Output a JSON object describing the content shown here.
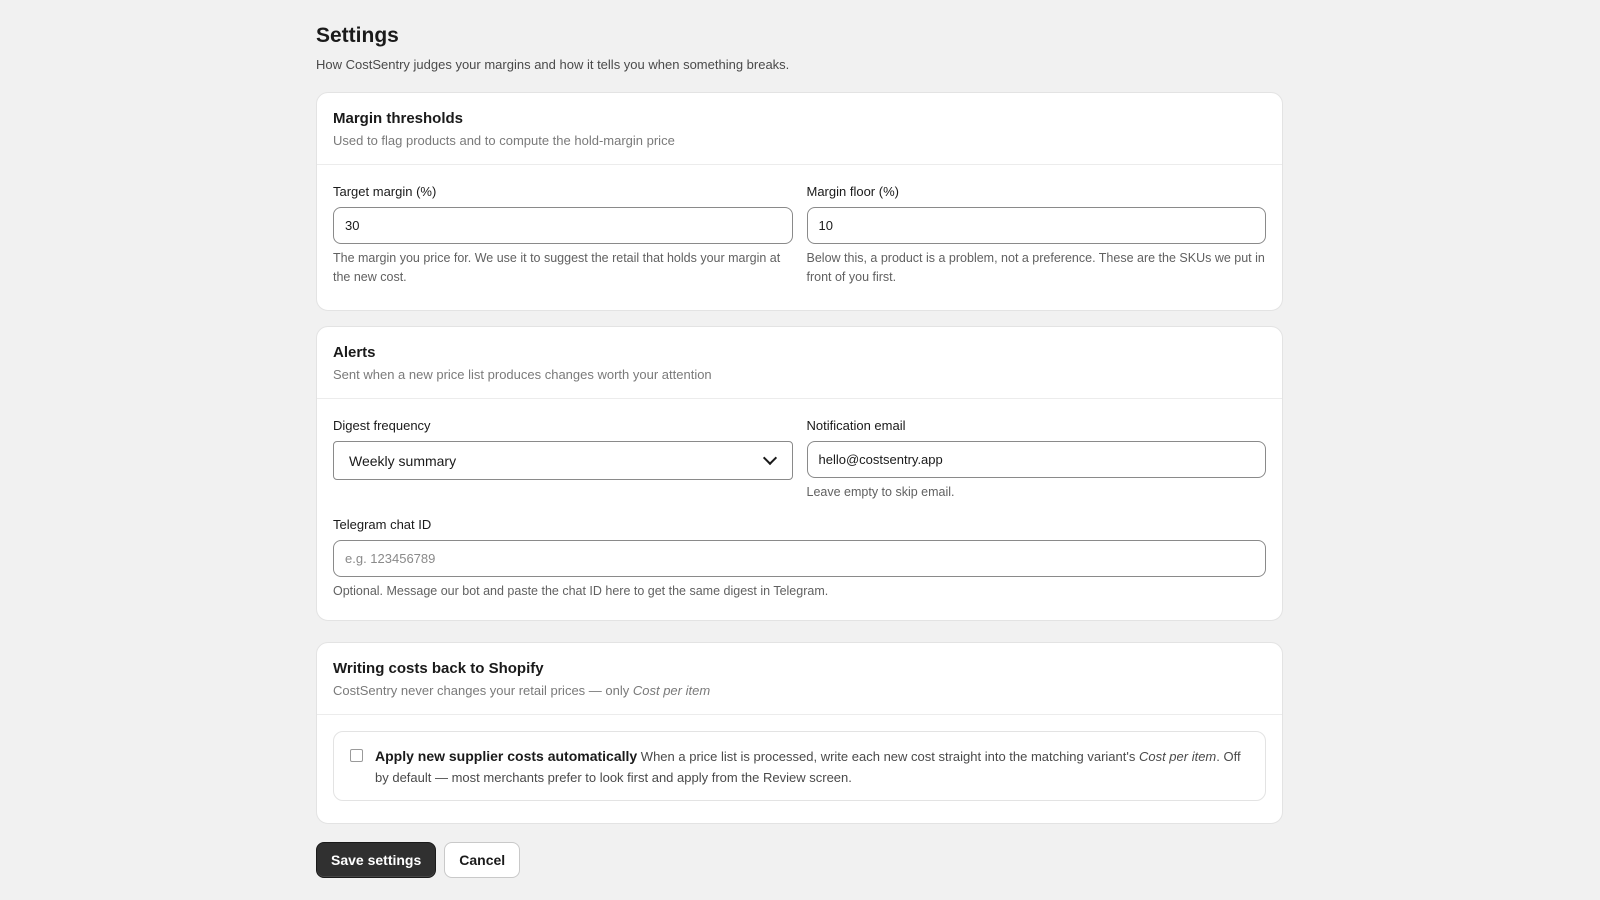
{
  "header": {
    "title": "Settings",
    "subtitle": "How CostSentry judges your margins and how it tells you when something breaks."
  },
  "margin_thresholds": {
    "title": "Margin thresholds",
    "description": "Used to flag products and to compute the hold-margin price",
    "target_margin": {
      "label": "Target margin (%)",
      "value": "30",
      "help": "The margin you price for. We use it to suggest the retail that holds your margin at the new cost."
    },
    "margin_floor": {
      "label": "Margin floor (%)",
      "value": "10",
      "help": "Below this, a product is a problem, not a preference. These are the SKUs we put in front of you first."
    }
  },
  "alerts": {
    "title": "Alerts",
    "description": "Sent when a new price list produces changes worth your attention",
    "digest_frequency": {
      "label": "Digest frequency",
      "selected": "Weekly summary",
      "icon": "chevron-down-icon"
    },
    "notification_email": {
      "label": "Notification email",
      "value": "hello@costsentry.app",
      "help": "Leave empty to skip email."
    },
    "telegram": {
      "label": "Telegram chat ID",
      "value": "",
      "placeholder": "e.g. 123456789",
      "help": "Optional. Message our bot and paste the chat ID here to get the same digest in Telegram."
    }
  },
  "shopify_writeback": {
    "title": "Writing costs back to Shopify",
    "description_prefix": "CostSentry never changes your retail prices — only ",
    "description_emphasis": "Cost per item",
    "auto_apply": {
      "checked": false,
      "label": "Apply new supplier costs automatically",
      "help_prefix": " When a price list is processed, write each new cost straight into the matching variant's ",
      "help_emphasis": "Cost per item",
      "help_suffix": ". Off by default — most merchants prefer to look first and apply from the Review screen."
    }
  },
  "actions": {
    "save_label": "Save settings",
    "cancel_label": "Cancel"
  },
  "colors": {
    "page_background": "#f1f1f1",
    "card_background": "#ffffff",
    "primary_button": "#303030",
    "muted_text": "#7a7a7a"
  }
}
